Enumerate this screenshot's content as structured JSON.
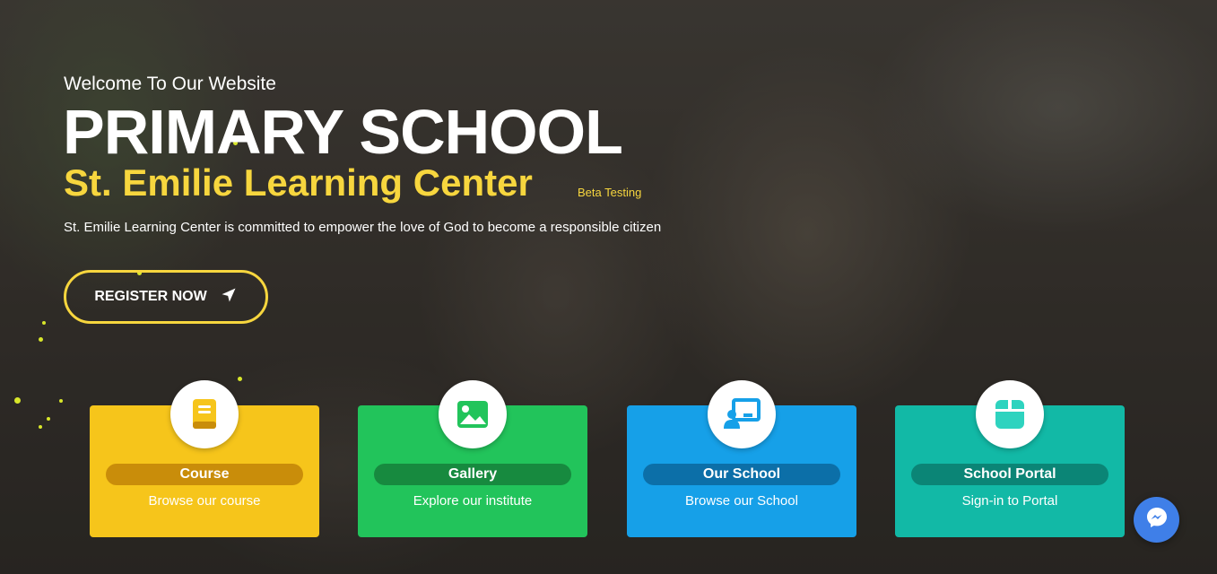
{
  "hero": {
    "welcome": "Welcome To Our Website",
    "headline": "PRIMARY SCHOOL",
    "subhead": "St. Emilie Learning Center",
    "beta": "Beta Testing",
    "tagline": "St. Emilie Learning Center is committed to empower the love of God to become a responsible citizen",
    "register_label": "REGISTER NOW"
  },
  "cards": [
    {
      "title": "Course",
      "desc": "Browse our course",
      "icon": "book-icon",
      "color": "#f6c51b"
    },
    {
      "title": "Gallery",
      "desc": "Explore our institute",
      "icon": "image-icon",
      "color": "#22c45b"
    },
    {
      "title": "Our School",
      "desc": "Browse our School",
      "icon": "presentation-icon",
      "color": "#16a0e8"
    },
    {
      "title": "School Portal",
      "desc": "Sign-in to Portal",
      "icon": "box-icon",
      "color": "#12b9a6"
    }
  ],
  "colors": {
    "accent": "#f7d63e",
    "messenger": "#3f7fe8"
  },
  "widgets": {
    "messenger_icon": "messenger-icon"
  }
}
